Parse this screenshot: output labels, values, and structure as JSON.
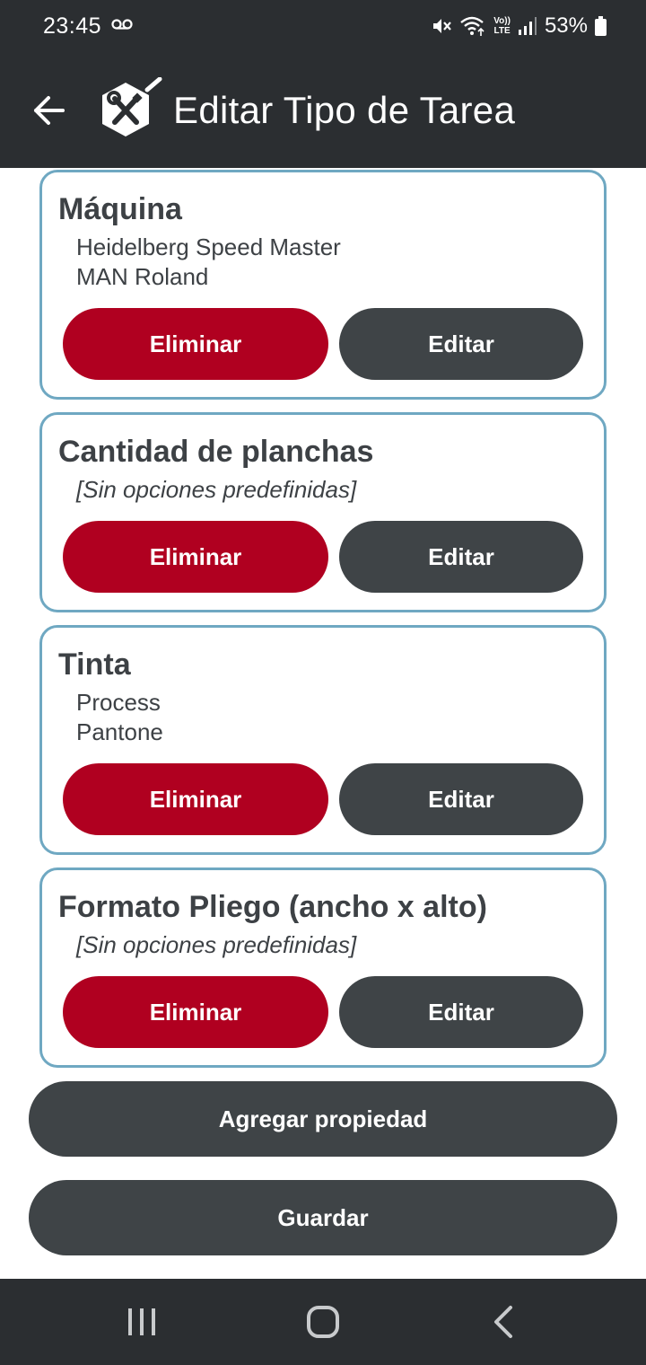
{
  "status_bar": {
    "time": "23:45",
    "battery": "53%",
    "lte_label": "LTE",
    "icons": [
      "voicemail-icon",
      "mute-icon",
      "wifi-icon",
      "lte-icon",
      "signal-icon",
      "battery-icon"
    ]
  },
  "app_bar": {
    "title": "Editar Tipo de Tarea",
    "icons": [
      "back-arrow-icon",
      "tools-logo-icon"
    ]
  },
  "properties": [
    {
      "title": "Máquina",
      "options": [
        "Heidelberg Speed Master",
        "MAN Roland"
      ],
      "delete_label": "Eliminar",
      "edit_label": "Editar"
    },
    {
      "title": "Cantidad de planchas",
      "options": [
        "[Sin opciones predefinidas]"
      ],
      "delete_label": "Eliminar",
      "edit_label": "Editar"
    },
    {
      "title": "Tinta",
      "options": [
        "Process",
        "Pantone"
      ],
      "delete_label": "Eliminar",
      "edit_label": "Editar"
    },
    {
      "title": "Formato Pliego (ancho x alto)",
      "options": [
        "[Sin opciones predefinidas]"
      ],
      "delete_label": "Eliminar",
      "edit_label": "Editar"
    }
  ],
  "actions": {
    "add_label": "Agregar propiedad",
    "save_label": "Guardar"
  },
  "colors": {
    "bar_background": "#2b2e31",
    "delete_button": "#b00020",
    "neutral_button": "#3f4447",
    "card_border": "#6fa8c2",
    "text": "#3d4145"
  },
  "nav_bar": {
    "icons": [
      "recent-apps-icon",
      "home-icon",
      "back-icon"
    ]
  }
}
